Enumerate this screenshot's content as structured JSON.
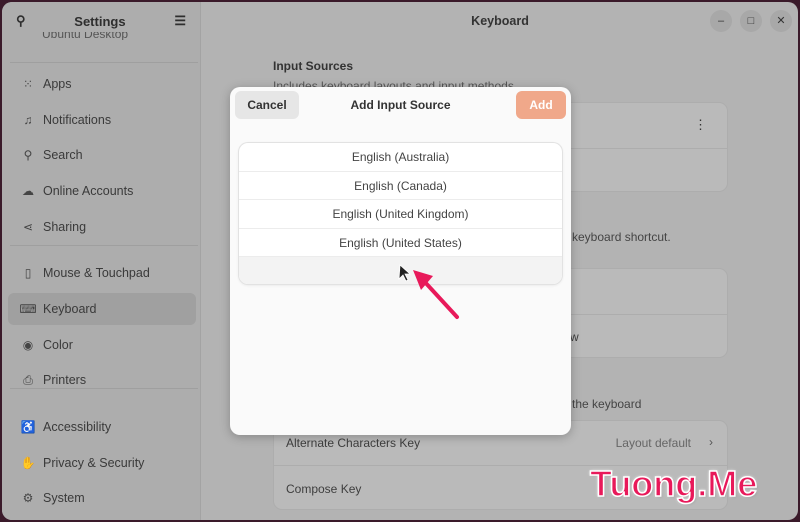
{
  "sidebar": {
    "title": "Settings",
    "partial_item": "Ubuntu Desktop",
    "items": [
      {
        "label": "Apps",
        "icon": "apps-grid-icon"
      },
      {
        "label": "Notifications",
        "icon": "bell-icon"
      },
      {
        "label": "Search",
        "icon": "search-icon"
      },
      {
        "label": "Online Accounts",
        "icon": "cloud-icon"
      },
      {
        "label": "Sharing",
        "icon": "share-icon"
      },
      {
        "label": "Mouse & Touchpad",
        "icon": "mouse-icon"
      },
      {
        "label": "Keyboard",
        "icon": "keyboard-icon",
        "active": true
      },
      {
        "label": "Color",
        "icon": "color-icon"
      },
      {
        "label": "Printers",
        "icon": "printer-icon"
      },
      {
        "label": "Accessibility",
        "icon": "accessibility-icon"
      },
      {
        "label": "Privacy & Security",
        "icon": "hand-icon"
      },
      {
        "label": "System",
        "icon": "gear-icon"
      }
    ]
  },
  "main": {
    "title": "Keyboard",
    "input_sources_heading": "Input Sources",
    "input_sources_desc": "Includes keyboard layouts and input methods",
    "shortcut_text": "keyboard shortcut.",
    "view_text": "w",
    "special_text": "the keyboard",
    "alt_chars_label": "Alternate Characters Key",
    "alt_chars_value": "Layout default",
    "compose_label": "Compose Key"
  },
  "dialog": {
    "title": "Add Input Source",
    "cancel": "Cancel",
    "add": "Add",
    "accent": "#e95420",
    "options": [
      "English (Australia)",
      "English (Canada)",
      "English (United Kingdom)",
      "English (United States)"
    ],
    "more": "⋮"
  },
  "watermark": "Tuong.Me"
}
